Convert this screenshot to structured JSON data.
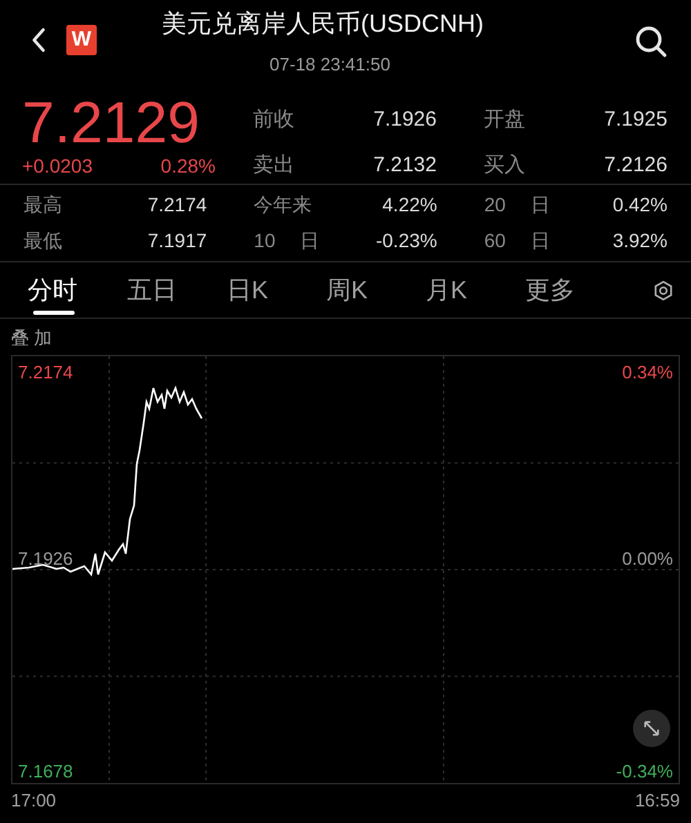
{
  "header": {
    "logo_text": "W",
    "title": "美元兑离岸人民币(USDCNH)",
    "timestamp": "07-18 23:41:50"
  },
  "quote": {
    "price": "7.2129",
    "change": "+0.0203",
    "change_pct": "0.28%",
    "fields": [
      [
        {
          "label": "前收",
          "value": "7.1926"
        },
        {
          "label": "开盘",
          "value": "7.1925"
        }
      ],
      [
        {
          "label": "卖出",
          "value": "7.2132"
        },
        {
          "label": "买入",
          "value": "7.2126"
        }
      ]
    ]
  },
  "stats": [
    [
      {
        "label": "最高",
        "value": "7.2174"
      },
      {
        "label": "今年来",
        "value": "4.22%"
      },
      {
        "label": "20 日",
        "value": "0.42%"
      }
    ],
    [
      {
        "label": "最低",
        "value": "7.1917"
      },
      {
        "label": "10 日",
        "value": "-0.23%"
      },
      {
        "label": "60 日",
        "value": "3.92%"
      }
    ]
  ],
  "tabs": [
    {
      "label": "分时",
      "selected": true
    },
    {
      "label": "五日",
      "selected": false
    },
    {
      "label": "日K",
      "selected": false
    },
    {
      "label": "周K",
      "selected": false
    },
    {
      "label": "月K",
      "selected": false
    },
    {
      "label": "更多",
      "selected": false
    }
  ],
  "overlay_label": "叠 加",
  "chart": {
    "left_labels": [
      "7.2174",
      "7.1926",
      "7.1678"
    ],
    "right_labels": [
      "0.34%",
      "0.00%",
      "-0.34%"
    ],
    "x_labels": [
      "17:00",
      "16:59"
    ]
  }
}
